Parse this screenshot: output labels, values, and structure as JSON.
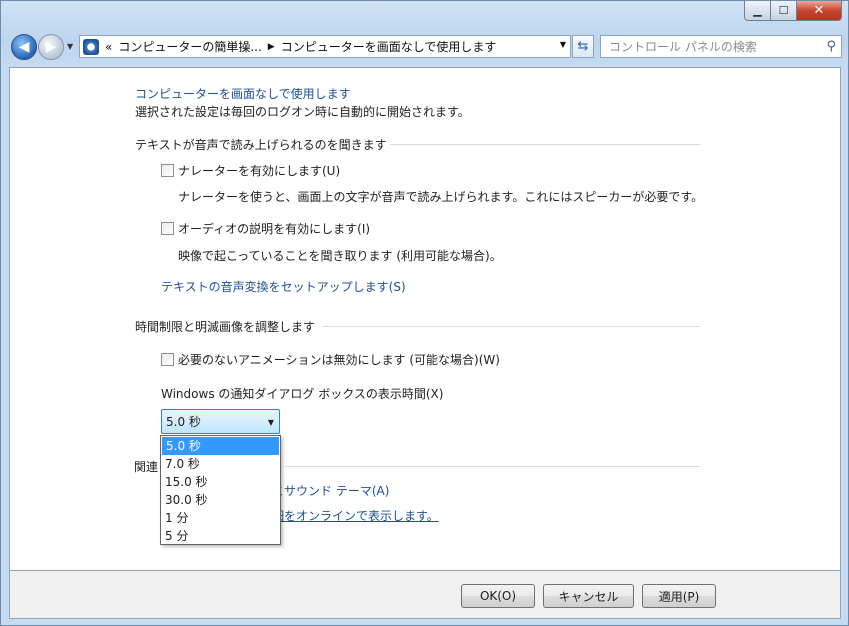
{
  "window": {
    "minimize_glyph": "▁",
    "maximize_glyph": "☐",
    "close_glyph": "✕"
  },
  "nav": {
    "back_glyph": "◀",
    "forward_glyph": "▶",
    "crumb_prefix": "«",
    "crumb_1": "コンピューターの簡単操...",
    "crumb_sep": "▶",
    "crumb_2": "コンピューターを画面なしで使用します",
    "search_placeholder": "コントロール パネルの検索"
  },
  "page": {
    "title": "コンピューターを画面なしで使用します",
    "subtitle": "選択された設定は毎回のログオン時に自動的に開始されます。",
    "section1_heading": "テキストが音声で読み上げられるのを聞きます",
    "narrator_label": "ナレーターを有効にします(U)",
    "narrator_desc": "ナレーターを使うと、画面上の文字が音声で読み上げられます。これにはスピーカーが必要です。",
    "audio_desc_label": "オーディオの説明を有効にします(I)",
    "audio_desc_desc": "映像で起こっていることを聞き取ります (利用可能な場合)。",
    "tts_link": "テキストの音声変換をセットアップします(S)",
    "section2_heading": "時間制限と明滅画像を調整します",
    "animations_label": "必要のないアニメーションは無効にします (可能な場合)(W)",
    "notify_label": "Windows の通知ダイアログ ボックスの表示時間(X)",
    "combo_value": "5.0 秒",
    "combo_options": [
      "5.0 秒",
      "7.0 秒",
      "15.0 秒",
      "30.0 秒",
      "1 分",
      "5 分"
    ],
    "section3_heading_partial": "関連",
    "related_link_1_partial": "とサウンド テーマ(A)",
    "related_link_2_partial": "細をオンラインで表示します。"
  },
  "buttons": {
    "ok": "OK(O)",
    "cancel": "キャンセル",
    "apply": "適用(P)"
  },
  "colors": {
    "link": "#1e4f96",
    "selection": "#3399ff"
  }
}
